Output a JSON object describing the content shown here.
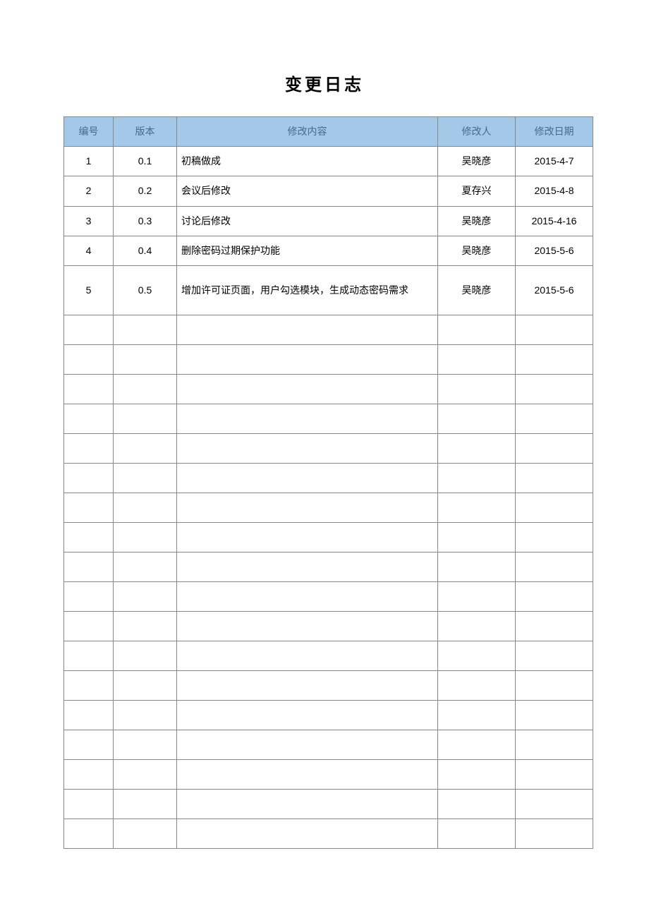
{
  "title": "变更日志",
  "headers": {
    "num": "编号",
    "version": "版本",
    "content": "修改内容",
    "author": "修改人",
    "date": "修改日期"
  },
  "rows": [
    {
      "num": "1",
      "version": "0.1",
      "content": "初稿做成",
      "author": "吴晓彦",
      "date": "2015-4-7"
    },
    {
      "num": "2",
      "version": "0.2",
      "content": "会议后修改",
      "author": "夏存兴",
      "date": "2015-4-8"
    },
    {
      "num": "3",
      "version": "0.3",
      "content": "讨论后修改",
      "author": "吴晓彦",
      "date": "2015-4-16"
    },
    {
      "num": "4",
      "version": "0.4",
      "content": "删除密码过期保护功能",
      "author": "吴晓彦",
      "date": "2015-5-6"
    },
    {
      "num": "5",
      "version": "0.5",
      "content": "增加许可证页面，用户勾选模块，生成动态密码需求",
      "author": "吴晓彦",
      "date": "2015-5-6"
    }
  ],
  "emptyRowCount": 18
}
